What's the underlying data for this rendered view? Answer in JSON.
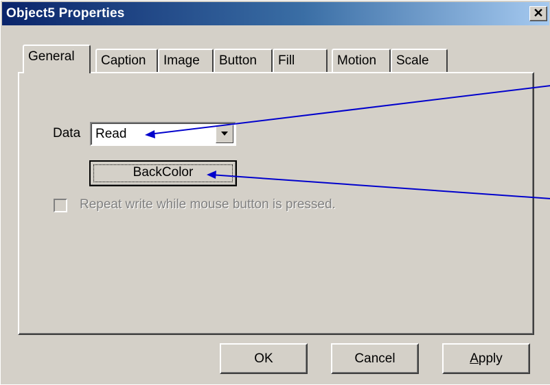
{
  "window": {
    "title": "Object5 Properties",
    "close_glyph": "✕"
  },
  "tabs": [
    {
      "label": "General",
      "active": true
    },
    {
      "label": "Caption"
    },
    {
      "label": "Image"
    },
    {
      "label": "Button"
    },
    {
      "label": "Fill"
    },
    {
      "label": "Motion"
    },
    {
      "label": "Scale"
    }
  ],
  "general": {
    "data_label": "Data",
    "data_value": "Read",
    "backcolor_label": "BackColor",
    "repeat_label": "Repeat write while mouse button is pressed.",
    "repeat_checked": false,
    "repeat_enabled": false
  },
  "buttons": {
    "ok": "OK",
    "cancel": "Cancel",
    "apply": "Apply"
  },
  "annotations": {
    "arrow_color": "#0000cc"
  },
  "colors": {
    "face": "#d4d0c8",
    "title_start": "#0a246a",
    "title_end": "#a6caf0"
  }
}
